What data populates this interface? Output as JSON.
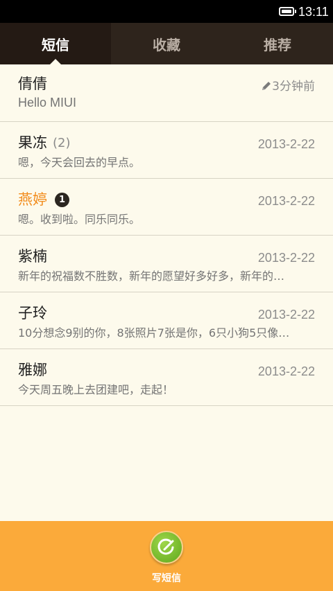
{
  "status_bar": {
    "time": "13:11"
  },
  "tabs": [
    {
      "label": "短信",
      "active": true
    },
    {
      "label": "收藏",
      "active": false
    },
    {
      "label": "推荐",
      "active": false
    }
  ],
  "conversations": [
    {
      "name": "倩倩",
      "draft_time": "3分钟前",
      "snippet": "Hello MIUI"
    },
    {
      "name": "果冻",
      "count": "(2)",
      "date": "2013-2-22",
      "snippet": "嗯，今天会回去的早点。"
    },
    {
      "name": "燕婷",
      "unread": "1",
      "date": "2013-2-22",
      "snippet": "嗯。收到啦。同乐同乐。"
    },
    {
      "name": "紫楠",
      "date": "2013-2-22",
      "snippet": "新年的祝福数不胜数，新年的愿望好多好多，新年的…"
    },
    {
      "name": "子玲",
      "date": "2013-2-22",
      "snippet": "10分想念9别的你，8张照片7张是你，6只小狗5只像…"
    },
    {
      "name": "雅娜",
      "date": "2013-2-22",
      "snippet": "今天周五晚上去团建吧，走起！"
    }
  ],
  "compose": {
    "label": "写短信",
    "icon": "compose-icon"
  },
  "colors": {
    "accent_orange": "#fbaa3a",
    "unread_name": "#f28c1c",
    "compose_green": "#6db32a",
    "tab_bar": "#2e241c"
  }
}
